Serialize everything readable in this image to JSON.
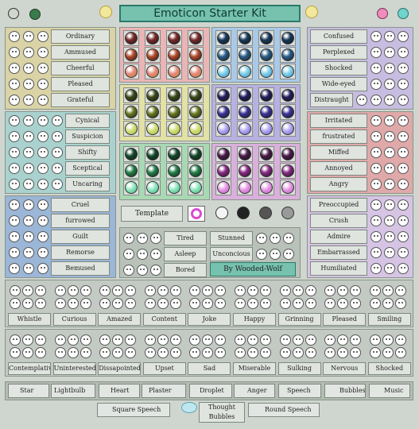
{
  "title": "Emoticon Starter Kit",
  "left_group_1": [
    "Ordinary",
    "Ammused",
    "Cheerful",
    "Pleased",
    "Grateful"
  ],
  "left_group_2": [
    "Cynical",
    "Suspicion",
    "Shifty",
    "Sceptical",
    "Uncaring"
  ],
  "left_group_3": [
    "Cruel",
    "furrowed",
    "Guilt",
    "Remorse",
    "Bemused"
  ],
  "right_group_1": [
    "Confused",
    "Perplexed",
    "Shocked",
    "Wide-eyed",
    "Distraught"
  ],
  "right_group_2": [
    "Irritated",
    "frustrated",
    "Miffed",
    "Annoyed",
    "Angry"
  ],
  "right_group_3": [
    "Preoccupied",
    "Crush",
    "Admire",
    "Embarrassed",
    "Humiliated"
  ],
  "center": {
    "template": "Template",
    "tired": "Tired",
    "asleep": "Asleep",
    "bored": "Bored",
    "stunned": "Stunned",
    "unconcious": "Unconcious",
    "credit": "By Wooded-Wolf"
  },
  "row1": [
    "Whistle",
    "Curious",
    "Amazed",
    "Content",
    "Joke",
    "Happy",
    "Grinning",
    "Pleased",
    "Smiling"
  ],
  "row2": [
    "Contemplative",
    "Uninterested",
    "Dissapointed",
    "Upset",
    "Sad",
    "Miserable",
    "Sulking",
    "Nervous",
    "Shocked"
  ],
  "bottom_items": [
    "Star",
    "Lightbulb",
    "Heart",
    "Plaster",
    "Droplet",
    "Anger",
    "Speech",
    "Bubbles",
    "Music"
  ],
  "bottom2": [
    "Square Speech",
    "Thought Bubbles",
    "Round Speech"
  ],
  "colors": {
    "titlebar": "#76c2ae",
    "panel": "#b6c0b6"
  }
}
